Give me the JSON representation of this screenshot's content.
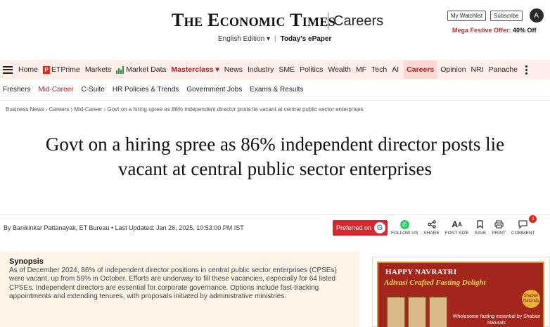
{
  "masthead": {
    "logo": "The Economic Times",
    "section": "Careers",
    "edition": "English Edition",
    "edition_caret": "▾",
    "divider": "|",
    "epaper": "Today's ePaper",
    "watchlist": "My Watchlist",
    "subscribe": "Subscribe",
    "avatar_initial": "A",
    "offer_text": "Mega Festive Offer:",
    "offer_value": "40% Off"
  },
  "nav": {
    "items": [
      {
        "label": "Home"
      },
      {
        "label": "ETPrime",
        "icon": "etprime-icon"
      },
      {
        "label": "Markets"
      },
      {
        "label": "Market Data",
        "icon": "market-data-icon"
      },
      {
        "label": "Masterclass ▾",
        "style": "red"
      },
      {
        "label": "News"
      },
      {
        "label": "Industry"
      },
      {
        "label": "SME"
      },
      {
        "label": "Politics"
      },
      {
        "label": "Wealth"
      },
      {
        "label": "MF"
      },
      {
        "label": "Tech"
      },
      {
        "label": "AI"
      },
      {
        "label": "Careers",
        "style": "active"
      },
      {
        "label": "Opinion"
      },
      {
        "label": "NRI"
      },
      {
        "label": "Panache"
      }
    ]
  },
  "subnav": {
    "items": [
      {
        "label": "Freshers"
      },
      {
        "label": "Mid-Career",
        "active": true
      },
      {
        "label": "C-Suite"
      },
      {
        "label": "HR Policies & Trends"
      },
      {
        "label": "Government Jobs"
      },
      {
        "label": "Exams & Results"
      }
    ]
  },
  "breadcrumb": "Business News › Careers › Mid-Career › Govt on a hiring spree as 86% independent director posts lie vacant at central public sector enterprises",
  "article": {
    "headline": "Govt on a hiring spree as 86% independent director posts lie vacant at central public sector enterprises",
    "byline_prefix": "By",
    "author": "Banikinkar Pattanayak, ET Bureau",
    "updated": "• Last Updated: Jan 26, 2025, 10:53:00 PM IST",
    "preferred_label": "Preferred on",
    "google_letter": "G"
  },
  "actions": [
    {
      "label": "FOLLOW US",
      "icon": "whatsapp-icon"
    },
    {
      "label": "SHARE",
      "icon": "share-icon"
    },
    {
      "label": "FONT SIZE",
      "icon": "font-size-icon"
    },
    {
      "label": "SAVE",
      "icon": "bookmark-icon"
    },
    {
      "label": "PRINT",
      "icon": "print-icon"
    },
    {
      "label": "COMMENT",
      "icon": "comment-icon",
      "badge": "1"
    }
  ],
  "synopsis": {
    "heading": "Synopsis",
    "text": "As of December 2024, 86% of independent director positions in central public sector enterprises (CPSEs) were vacant, up from 59% in October. Efforts are underway to fill these vacancies, especially for 64 listed CPSEs. Independent directors are essential for corporate governance. Options include fast-tracking appointments and extending tenures, with proposals initiated by administrative ministries."
  },
  "ad": {
    "title1": "HAPPY NAVRATRI",
    "title2": "Adivasi Crafted Fasting Delight",
    "emblem": "Shabari Naturals",
    "tagline": "Wholesome fasting essential by Shabari Naturals"
  },
  "colors": {
    "brand_red": "#c4161c",
    "nav_bg": "#fdeeea",
    "synopsis_bg": "#fdf3e7"
  }
}
